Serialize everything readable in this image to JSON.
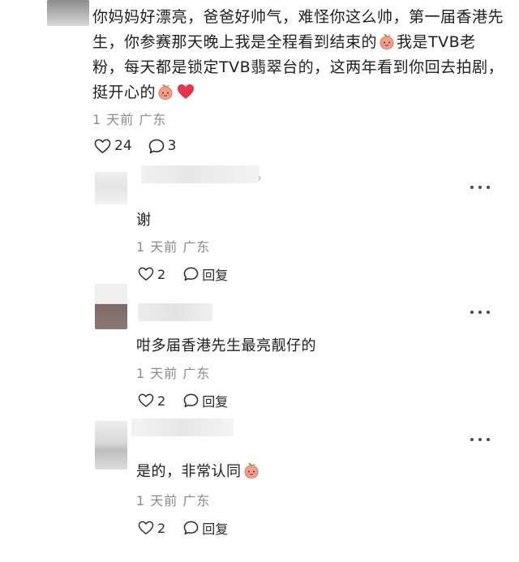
{
  "main_comment": {
    "text_part1": "你妈妈好漂亮，爸爸好帅气，难怪你这么帅，第一届香港先生，你参赛那天晚上我是全程看到结束的",
    "text_part2": "我是TVB老粉，每天都是锁定TVB翡翠台的，这两年看到你回去拍剧，挺开心的",
    "time": "1 天前",
    "location": "广东",
    "likes": "24",
    "replies": "3",
    "like_icon": "heart-outline-icon",
    "reply_icon": "speech-bubble-icon"
  },
  "replies": [
    {
      "text": "谢",
      "time": "1 天前",
      "location": "广东",
      "likes": "2",
      "reply_label": "回复",
      "name_mark": "⁷"
    },
    {
      "text": "咁多届香港先生最亮靓仔的",
      "time": "1 天前",
      "location": "广东",
      "likes": "2",
      "reply_label": "回复"
    },
    {
      "text": "是的，非常认同",
      "time": "1 天前",
      "location": "广东",
      "likes": "2",
      "reply_label": "回复"
    }
  ],
  "icons": {
    "more": "more-dots-icon",
    "peach_emoji": "peach-face-emoji-icon",
    "heart_emoji": "red-heart-emoji-icon"
  },
  "colors": {
    "meta_gray": "#8a8a8a",
    "heart_red": "#e8344a",
    "peach": "#f5a08f"
  }
}
